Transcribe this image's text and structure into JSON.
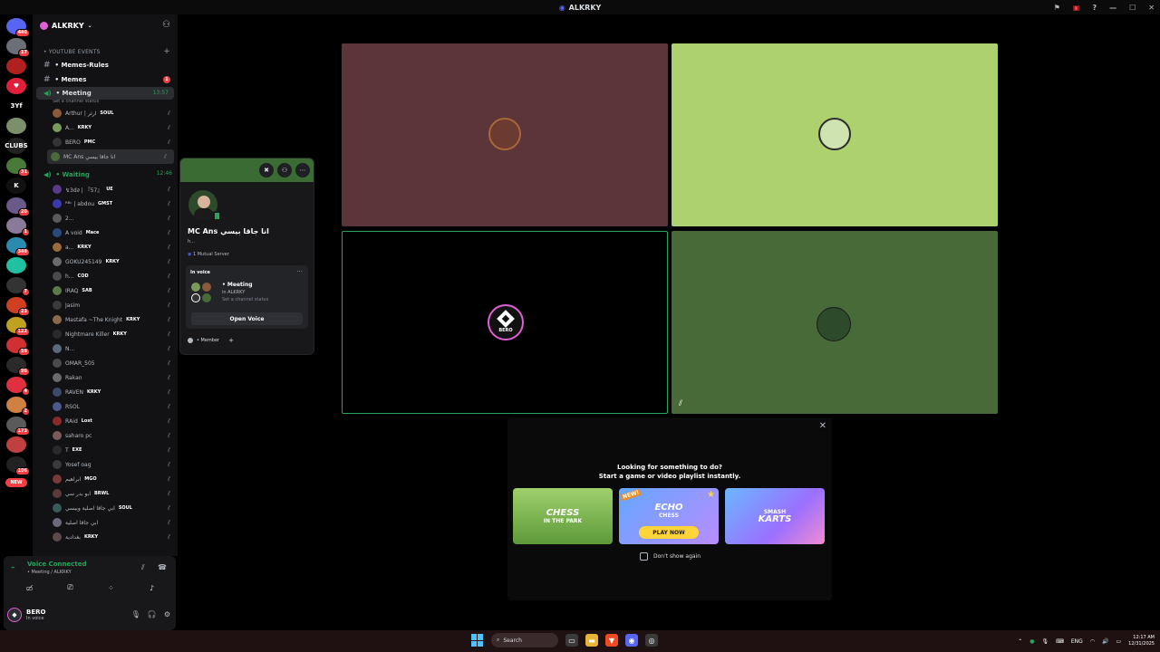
{
  "window": {
    "title": "ALKRKY",
    "controls": {
      "minimize": "—",
      "maximize": "☐",
      "close": "✕"
    }
  },
  "rail": {
    "servers": [
      {
        "label": "",
        "color": "#5865f2",
        "badge": "440"
      },
      {
        "label": "",
        "color": "#6d6f78",
        "badge": "17"
      },
      {
        "label": "",
        "color": "#b02020",
        "badge": ""
      },
      {
        "label": "♥",
        "color": "#e0203a",
        "badge": ""
      },
      {
        "label": "3Yf",
        "color": "#000000",
        "badge": ""
      },
      {
        "label": "",
        "color": "#7a8f6a",
        "badge": ""
      },
      {
        "label": "CLUBS",
        "color": "#222222",
        "badge": ""
      },
      {
        "label": "",
        "color": "#4a7a3a",
        "badge": "31"
      },
      {
        "label": "K",
        "color": "#111111",
        "badge": ""
      },
      {
        "label": "",
        "color": "#6a5a8a",
        "badge": "20"
      },
      {
        "label": "",
        "color": "#8a7a9a",
        "badge": "1"
      },
      {
        "label": "",
        "color": "#2a8ab0",
        "badge": "348"
      },
      {
        "label": "",
        "color": "#20c0a0",
        "badge": ""
      },
      {
        "label": "",
        "color": "#333333",
        "badge": "7"
      },
      {
        "label": "",
        "color": "#d04020",
        "badge": "23"
      },
      {
        "label": "",
        "color": "#c0a020",
        "badge": "122"
      },
      {
        "label": "",
        "color": "#d03030",
        "badge": "58"
      },
      {
        "label": "",
        "color": "#2a2a2a",
        "badge": "96"
      },
      {
        "label": "",
        "color": "#e03040",
        "badge": "4"
      },
      {
        "label": "",
        "color": "#d08040",
        "badge": "2"
      },
      {
        "label": "",
        "color": "#5a5a5a",
        "badge": "173"
      },
      {
        "label": "",
        "color": "#c04040",
        "badge": ""
      },
      {
        "label": "",
        "color": "#222222",
        "badge": "106"
      }
    ],
    "new_label": "NEW"
  },
  "sidebar": {
    "server_name": "ALKRKY",
    "category": "• YOUTUBE EVENTS",
    "text_channels": [
      {
        "name": "• Memes-Rules",
        "unread": ""
      },
      {
        "name": "• Memes",
        "unread": "1"
      }
    ],
    "meeting": {
      "name": "• Meeting",
      "timer": "13:57",
      "status": "Set a channel status",
      "members": [
        {
          "name": "Arthur | آرثر",
          "tag": "SOUL",
          "color": "#8a5a3a"
        },
        {
          "name": "A...",
          "tag": "KRKY",
          "color": "#7a9a5a"
        },
        {
          "name": "BERO",
          "tag": "PMC",
          "color": "#333333"
        },
        {
          "name": "MC Ans انا جاقا بيسي",
          "tag": "",
          "color": "#4a6a3a"
        }
      ]
    },
    "waiting": {
      "name": "• Waiting",
      "timer": "12:46",
      "members": [
        {
          "name": "↯3d∂ | 『57』",
          "tag": "UE",
          "color": "#5a3a8a"
        },
        {
          "name": "ᴿᴮᶜ | abdou",
          "tag": "GMST",
          "color": "#3a3aaa"
        },
        {
          "name": "2...",
          "tag": "",
          "color": "#5a5a5a"
        },
        {
          "name": "A void",
          "tag": "Mace",
          "color": "#2a4a7a"
        },
        {
          "name": "a...",
          "tag": "KRKY",
          "color": "#9a6a3a"
        },
        {
          "name": "GOKU245149",
          "tag": "KRKY",
          "color": "#6a6a6a"
        },
        {
          "name": "h...",
          "tag": "COD",
          "color": "#4a4a4a"
        },
        {
          "name": "IRAQ",
          "tag": "SAB",
          "color": "#5a7a4a"
        },
        {
          "name": "Jasim",
          "tag": "",
          "color": "#3a3a3a"
        },
        {
          "name": "Mastafa ~The Knight",
          "tag": "KRKY",
          "color": "#8a6a4a"
        },
        {
          "name": "Nightmare Killer",
          "tag": "KRKY",
          "color": "#2a2a2a"
        },
        {
          "name": "N...",
          "tag": "",
          "color": "#5a6a7a"
        },
        {
          "name": "OMAR_505",
          "tag": "",
          "color": "#4a4a4a"
        },
        {
          "name": "Rakan",
          "tag": "",
          "color": "#6a6a6a"
        },
        {
          "name": "RAVEN",
          "tag": "KRKY",
          "color": "#3a4a6a"
        },
        {
          "name": "RSOL",
          "tag": "",
          "color": "#4a5a8a"
        },
        {
          "name": "RĀid",
          "tag": "Lost",
          "color": "#8a2a2a"
        },
        {
          "name": "saharo pc",
          "tag": "",
          "color": "#7a5a5a"
        },
        {
          "name": "T",
          "tag": "EXE",
          "color": "#2a2a2a"
        },
        {
          "name": "Yosef oag",
          "tag": "",
          "color": "#3a3a3a"
        },
        {
          "name": "ابراهيم",
          "tag": "MGO",
          "color": "#7a3a3a"
        },
        {
          "name": "ابو بدر سي",
          "tag": "BRWL",
          "color": "#5a3a3a"
        },
        {
          "name": "ابي جاقا اصلية وبيسي",
          "tag": "SOUL",
          "color": "#3a5a5a"
        },
        {
          "name": "ابي جاقا اصلية",
          "tag": "",
          "color": "#6a6a7a"
        },
        {
          "name": "بغدادية",
          "tag": "KRKY",
          "color": "#5a4a4a"
        }
      ]
    }
  },
  "voice_panel": {
    "status": "Voice Connected",
    "sub": "• Meeting / ALKRKY",
    "user_name": "BERO",
    "user_status": "In voice"
  },
  "popout": {
    "name": "MC Ans انا جاقا بيسي",
    "handle": "h...",
    "mutual": "1 Mutual Server",
    "in_voice_label": "In voice",
    "voice_channel": "• Meeting",
    "voice_server": "in ALKRKY",
    "voice_status": "Set a channel status",
    "open_voice": "Open Voice",
    "role": "• Member",
    "more": "···",
    "add_role": "+"
  },
  "tiles": {
    "colors": [
      "#5b353a",
      "#aed16f",
      "#000000",
      "#486a39"
    ],
    "bero_label": "BERO"
  },
  "activity": {
    "title_line1": "Looking for something to do?",
    "title_line2": "Start a game or video playlist instantly.",
    "cards": [
      {
        "title": "CHESS",
        "sub": "IN THE PARK"
      },
      {
        "title": "ECHO",
        "sub": "CHESS",
        "new": "NEW!",
        "play": "PLAY NOW"
      },
      {
        "title": "SMASH",
        "sub": "KARTS"
      }
    ],
    "dont_show": "Don't show again"
  },
  "taskbar": {
    "search": "Search",
    "lang": "ENG",
    "time": "12:17 AM",
    "date": "12/31/2025"
  }
}
